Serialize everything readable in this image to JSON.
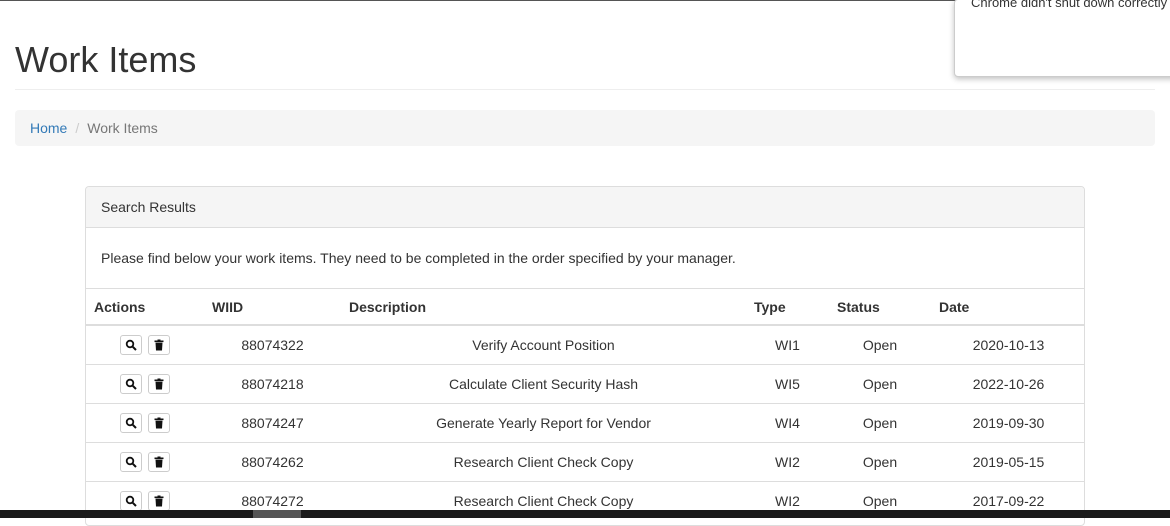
{
  "page": {
    "title": "Work Items"
  },
  "breadcrumb": {
    "home": "Home",
    "separator": "/",
    "current": "Work Items"
  },
  "panel": {
    "heading": "Search Results",
    "body": "Please find below your work items. They need to be completed in the order specified by your manager."
  },
  "table": {
    "headers": {
      "actions": "Actions",
      "wiid": "WIID",
      "description": "Description",
      "type": "Type",
      "status": "Status",
      "date": "Date"
    },
    "rows": [
      {
        "wiid": "88074322",
        "description": "Verify Account Position",
        "type": "WI1",
        "status": "Open",
        "date": "2020-10-13"
      },
      {
        "wiid": "88074218",
        "description": "Calculate Client Security Hash",
        "type": "WI5",
        "status": "Open",
        "date": "2022-10-26"
      },
      {
        "wiid": "88074247",
        "description": "Generate Yearly Report for Vendor",
        "type": "WI4",
        "status": "Open",
        "date": "2019-09-30"
      },
      {
        "wiid": "88074262",
        "description": "Research Client Check Copy",
        "type": "WI2",
        "status": "Open",
        "date": "2019-05-15"
      },
      {
        "wiid": "88074272",
        "description": "Research Client Check Copy",
        "type": "WI2",
        "status": "Open",
        "date": "2017-09-22"
      }
    ]
  },
  "notification": {
    "text": "Chrome didn't shut down correctly"
  },
  "icons": {
    "view": "search-icon",
    "delete": "trash-icon"
  },
  "colors": {
    "link": "#337ab7",
    "panel_heading_bg": "#f5f5f5",
    "border": "#dddddd"
  }
}
